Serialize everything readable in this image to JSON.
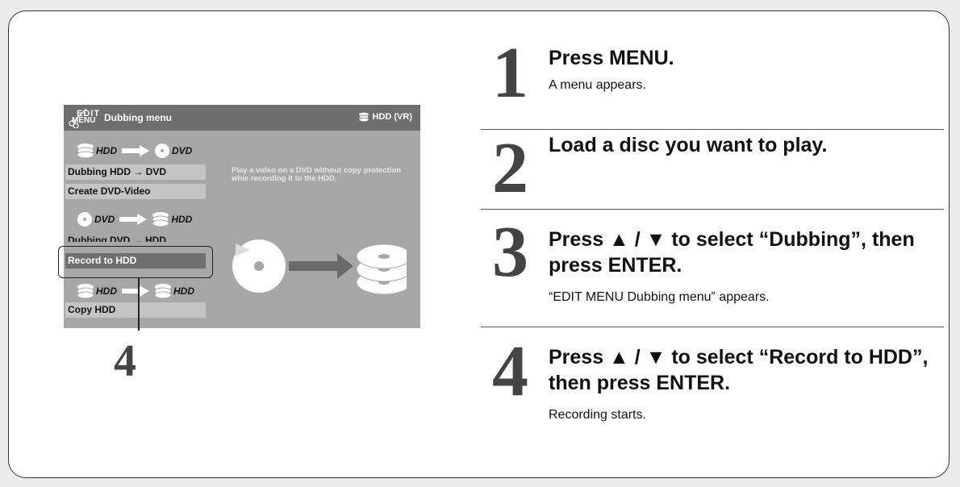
{
  "screen": {
    "logo_line1": "EDIT",
    "logo_line2": "MENU",
    "title": "Dubbing menu",
    "mode": "HDD (VR)",
    "routes": [
      {
        "from": "HDD",
        "to": "DVD"
      },
      {
        "from": "DVD",
        "to": "HDD"
      },
      {
        "from": "HDD",
        "to": "HDD"
      }
    ],
    "menu_items": [
      "Dubbing HDD → DVD",
      "Create DVD-Video",
      "Dubbing DVD → HDD",
      "Record to HDD",
      "Copy HDD"
    ],
    "selected_item": "Record to HDD",
    "description": "Play a video on a DVD without copy protection whie recording it to the HDD."
  },
  "callout": "4",
  "steps": [
    {
      "number": "1",
      "title": "Press MENU.",
      "text": "A menu appears."
    },
    {
      "number": "2",
      "title": "Load a disc you want to play.",
      "text": ""
    },
    {
      "number": "3",
      "title": "Press ▲ / ▼ to select “Dubbing”, then press ENTER.",
      "text": "“EDIT MENU Dubbing menu” appears."
    },
    {
      "number": "4",
      "title": "Press ▲ / ▼ to select “Record to HDD”, then press ENTER.",
      "text": "Recording starts."
    }
  ],
  "colors": {
    "background": "#ebebeb",
    "screen_body": "#a7a7a7",
    "screen_header": "#6e6e6e",
    "selected_item": "#6f6f6f",
    "step_number": "#444444"
  },
  "icons": [
    "hdd-icon",
    "dvd-icon",
    "arrow-right-icon",
    "disc-icon",
    "hdd-stack-icon"
  ]
}
